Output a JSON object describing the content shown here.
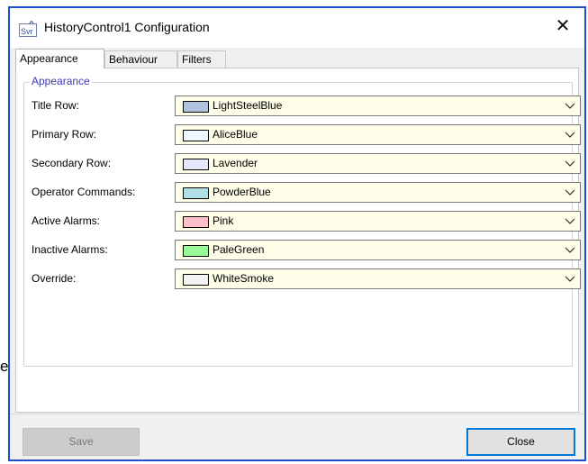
{
  "window": {
    "title": "HistoryControl1 Configuration",
    "close_glyph": "✕",
    "icon": "svr-app-icon",
    "stray_text": "e"
  },
  "tabs": [
    {
      "label": "Appearance",
      "active": true
    },
    {
      "label": "Behaviour",
      "active": false
    },
    {
      "label": "Filters",
      "active": false
    }
  ],
  "group": {
    "legend": "Appearance",
    "rows": [
      {
        "label": "Title Row:",
        "value": "LightSteelBlue",
        "color": "#b0c4de"
      },
      {
        "label": "Primary Row:",
        "value": "AliceBlue",
        "color": "#f0f8ff"
      },
      {
        "label": "Secondary Row:",
        "value": "Lavender",
        "color": "#e6e6fa"
      },
      {
        "label": "Operator Commands:",
        "value": "PowderBlue",
        "color": "#b0e0e6"
      },
      {
        "label": "Active Alarms:",
        "value": "Pink",
        "color": "#ffc0cb"
      },
      {
        "label": "Inactive Alarms:",
        "value": "PaleGreen",
        "color": "#98fb98"
      },
      {
        "label": "Override:",
        "value": "WhiteSmoke",
        "color": "#f5f5f5"
      }
    ]
  },
  "buttons": {
    "save_label": "Save",
    "close_label": "Close"
  },
  "colors": {
    "window_border": "#1f4ed0",
    "field_background": "#fdfde8",
    "focus_border": "#0078d7"
  }
}
